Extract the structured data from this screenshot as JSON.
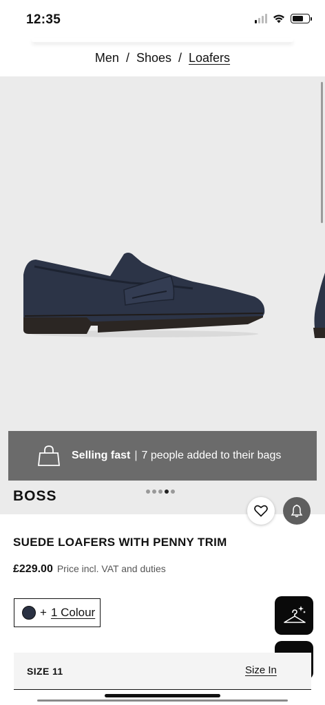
{
  "status_bar": {
    "time": "12:35"
  },
  "breadcrumb": {
    "items": [
      "Men",
      "Shoes",
      "Loafers"
    ],
    "separator": "/"
  },
  "banner": {
    "title": "Selling fast",
    "separator": "|",
    "text": "7 people added to their bags"
  },
  "brand": {
    "logo_text": "BOSS"
  },
  "carousel": {
    "dot_count": 5,
    "active_index": 3
  },
  "product": {
    "title": "SUEDE LOAFERS WITH PENNY TRIM",
    "price": "£229.00",
    "price_note": "Price incl. VAT and duties",
    "colour_prefix": "+",
    "colour_link": "1 Colour",
    "swatch_color": "#2a3142"
  },
  "size": {
    "label": "SIZE 11",
    "guide_link": "Size In"
  },
  "icons": {
    "banner": "shopping-bag-icon",
    "wishlist": "heart-icon",
    "notify": "bell-icon",
    "fab_top": "hanger-sparkle-icon",
    "fab_bottom": "more-dots-icon"
  },
  "colors": {
    "banner_bg": "#6b6b6b",
    "image_bg": "#ebebeb",
    "fab_bg": "#0a0a0a"
  }
}
